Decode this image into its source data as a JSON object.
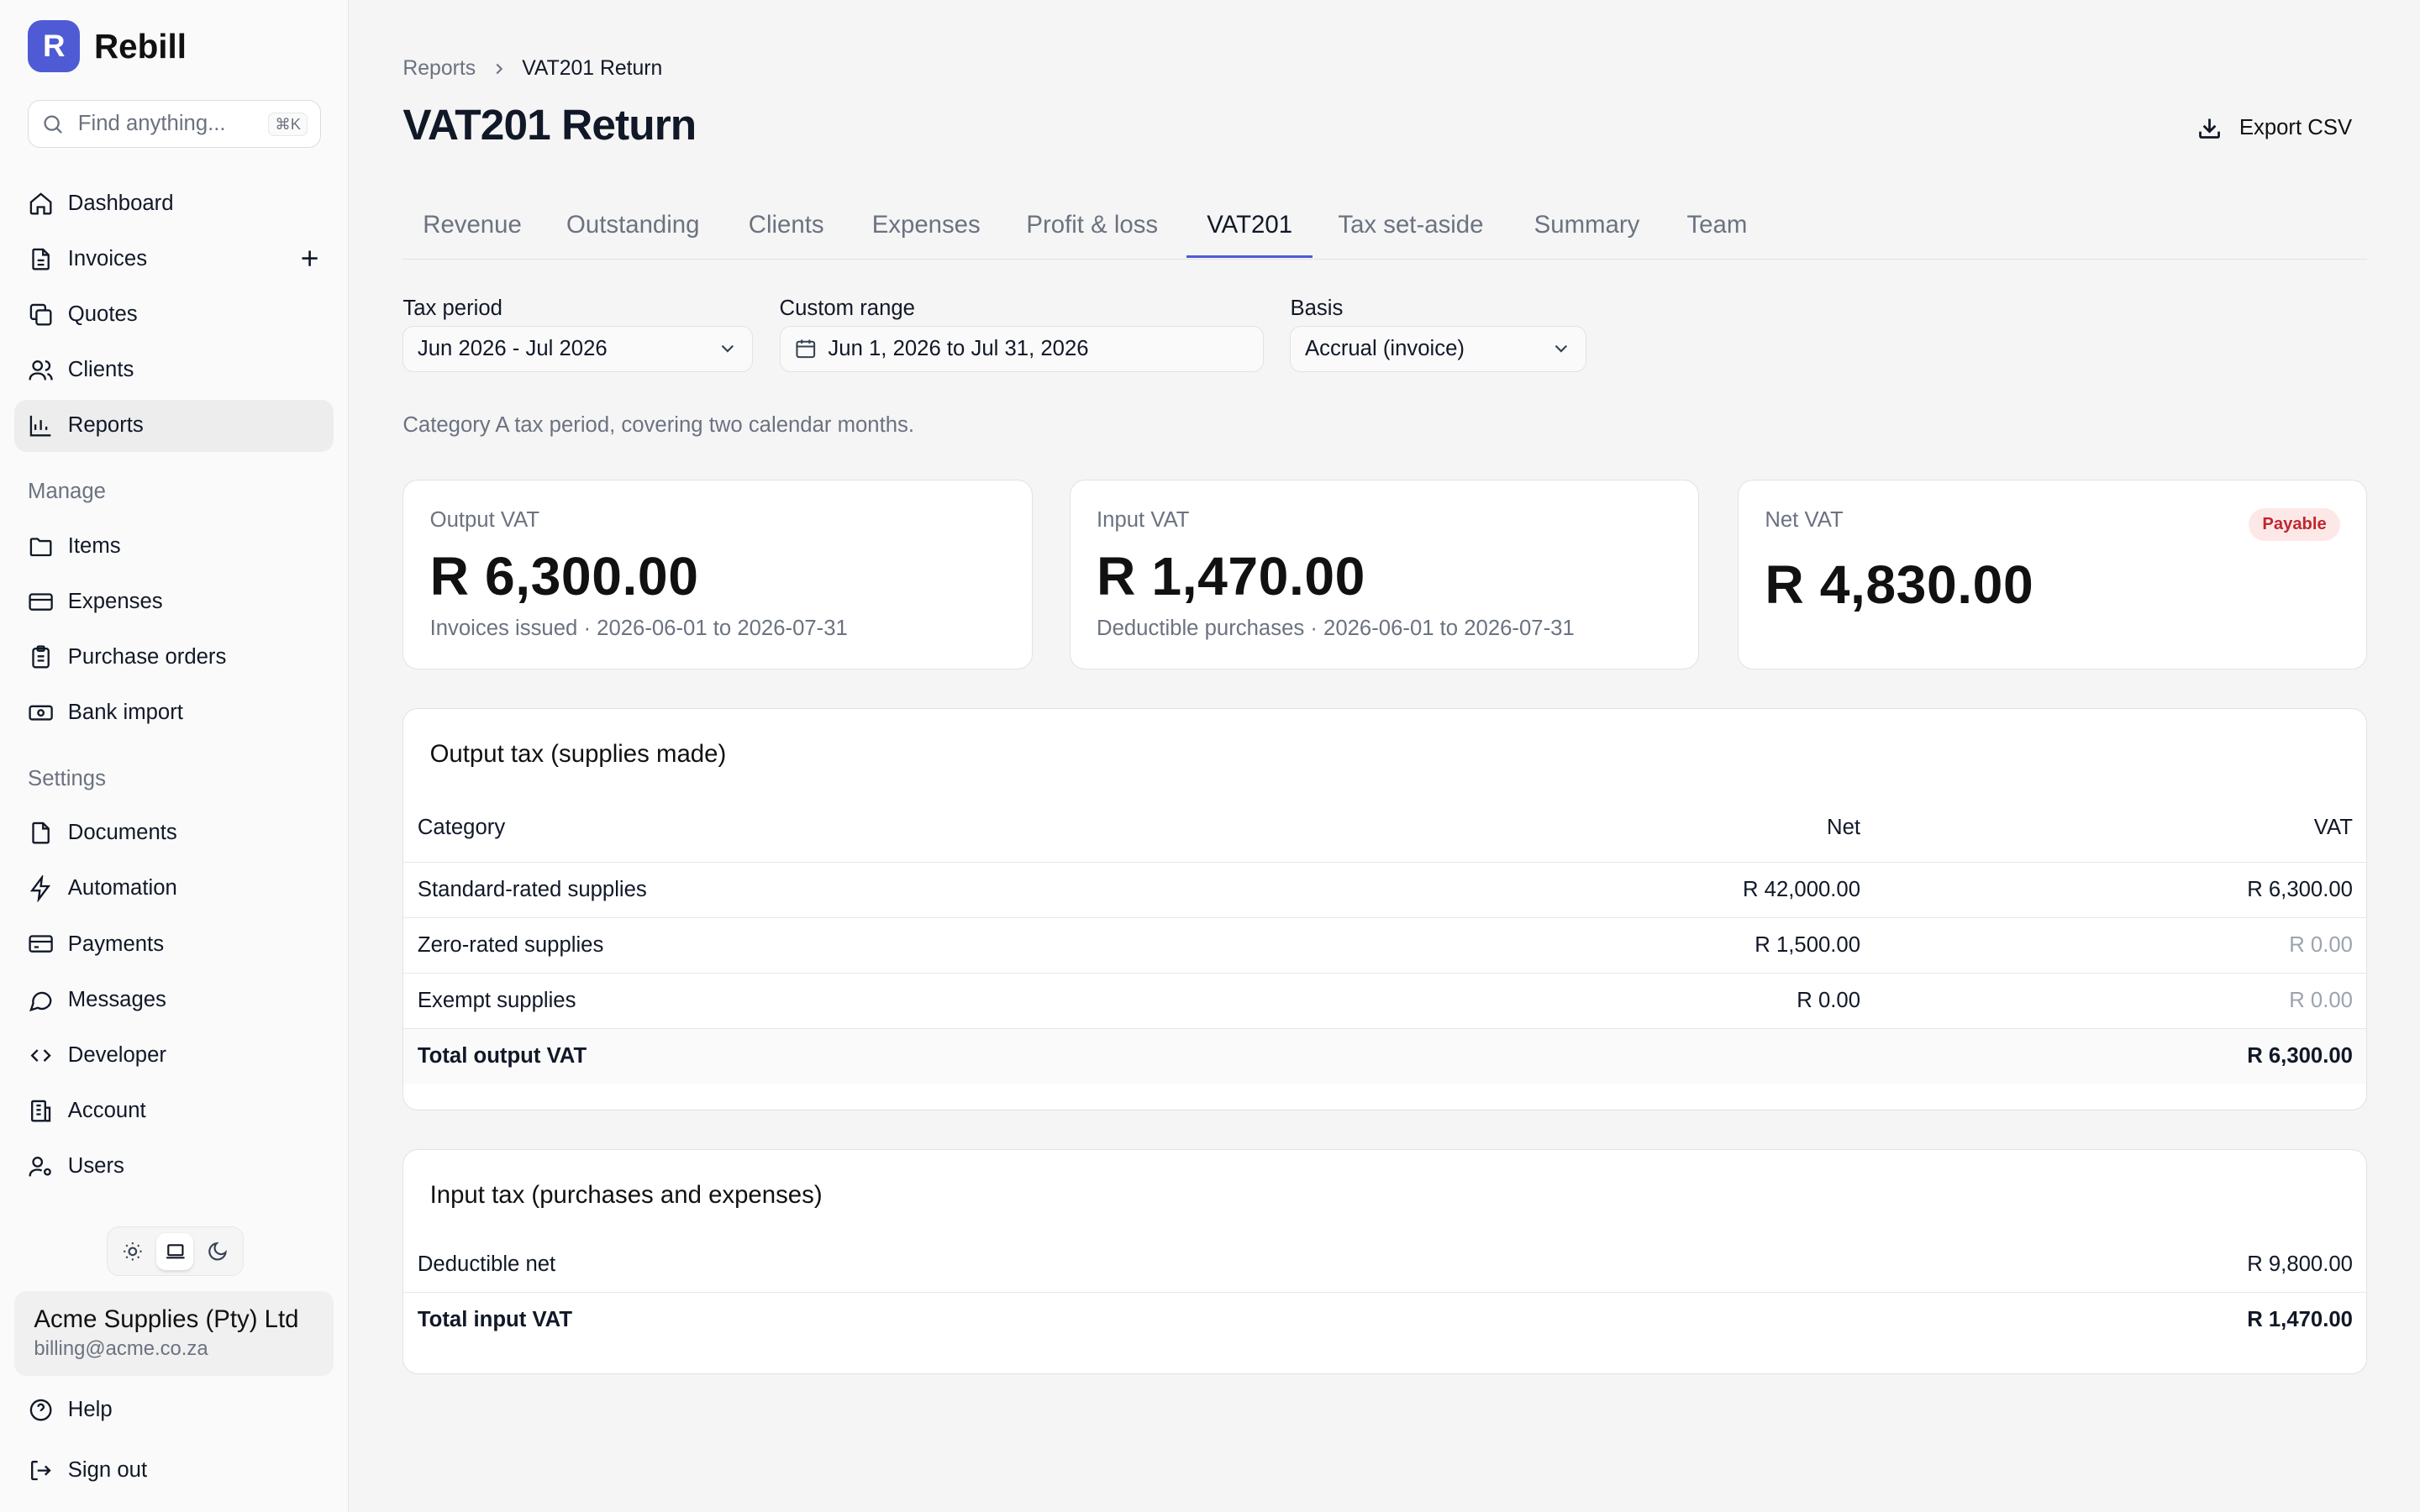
{
  "brand": {
    "logo_letter": "R",
    "name": "Rebill",
    "accent": "#4f5bd5"
  },
  "search": {
    "placeholder": "Find anything...",
    "shortcut": "⌘K"
  },
  "nav": {
    "primary": [
      {
        "label": "Dashboard",
        "icon": "home-icon"
      },
      {
        "label": "Invoices",
        "icon": "file-icon"
      },
      {
        "label": "Quotes",
        "icon": "copy-icon"
      },
      {
        "label": "Clients",
        "icon": "users-icon"
      },
      {
        "label": "Reports",
        "icon": "chart-icon",
        "active": true
      }
    ],
    "manage_heading": "Manage",
    "manage": [
      {
        "label": "Items",
        "icon": "folder-icon"
      },
      {
        "label": "Expenses",
        "icon": "credit-card-icon"
      },
      {
        "label": "Purchase orders",
        "icon": "clipboard-icon"
      },
      {
        "label": "Bank import",
        "icon": "banknote-icon"
      }
    ],
    "settings_heading": "Settings",
    "settings": [
      {
        "label": "Documents",
        "icon": "document-icon"
      },
      {
        "label": "Automation",
        "icon": "zap-icon"
      },
      {
        "label": "Payments",
        "icon": "card-icon"
      },
      {
        "label": "Messages",
        "icon": "message-icon"
      },
      {
        "label": "Developer",
        "icon": "code-icon"
      },
      {
        "label": "Account",
        "icon": "building-icon"
      },
      {
        "label": "Users",
        "icon": "user-cog-icon"
      }
    ],
    "help": "Help",
    "sign_out": "Sign out"
  },
  "account": {
    "name": "Acme Supplies (Pty) Ltd",
    "email": "billing@acme.co.za"
  },
  "breadcrumb": {
    "parent": "Reports",
    "current": "VAT201 Return"
  },
  "page": {
    "title": "VAT201 Return",
    "export_label": "Export CSV"
  },
  "tabs": [
    {
      "label": "Revenue"
    },
    {
      "label": "Outstanding"
    },
    {
      "label": "Clients"
    },
    {
      "label": "Expenses"
    },
    {
      "label": "Profit & loss"
    },
    {
      "label": "VAT201",
      "active": true
    },
    {
      "label": "Tax set-aside"
    },
    {
      "label": "Summary"
    },
    {
      "label": "Team"
    }
  ],
  "filters": {
    "tax_period": {
      "label": "Tax period",
      "value": "Jun 2026 - Jul 2026"
    },
    "custom_range": {
      "label": "Custom range",
      "value": "Jun 1, 2026 to Jul 31, 2026"
    },
    "basis": {
      "label": "Basis",
      "value": "Accrual (invoice)"
    }
  },
  "period_note": "Category A tax period, covering two calendar months.",
  "stats": {
    "output": {
      "label": "Output VAT",
      "value": "R 6,300.00",
      "sub": "Invoices issued · 2026-06-01 to 2026-07-31"
    },
    "input": {
      "label": "Input VAT",
      "value": "R 1,470.00",
      "sub": "Deductible purchases · 2026-06-01 to 2026-07-31"
    },
    "net": {
      "label": "Net VAT",
      "value": "R 4,830.00",
      "badge": "Payable",
      "badge_color": "#c0272d"
    }
  },
  "output_tax": {
    "title": "Output tax (supplies made)",
    "columns": [
      "Category",
      "Net",
      "VAT"
    ],
    "rows": [
      {
        "category": "Standard-rated supplies",
        "net": "R 42,000.00",
        "vat": "R 6,300.00"
      },
      {
        "category": "Zero-rated supplies",
        "net": "R 1,500.00",
        "vat": "R 0.00"
      },
      {
        "category": "Exempt supplies",
        "net": "R 0.00",
        "vat": "R 0.00"
      }
    ],
    "total_label": "Total output VAT",
    "total_value": "R 6,300.00"
  },
  "input_tax": {
    "title": "Input tax (purchases and expenses)",
    "rows": [
      {
        "label": "Deductible net",
        "value": "R 9,800.00"
      }
    ],
    "total_label": "Total input VAT",
    "total_value": "R 1,470.00"
  }
}
